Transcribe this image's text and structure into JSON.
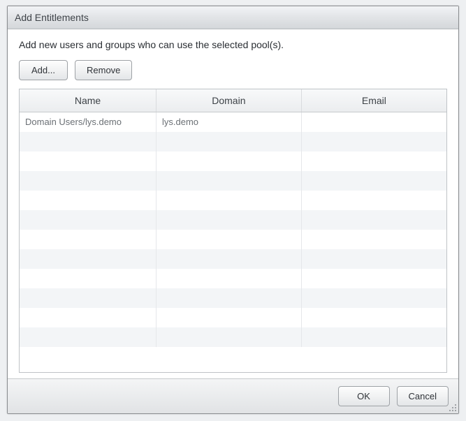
{
  "dialog": {
    "title": "Add Entitlements",
    "description": "Add new users and groups who can use the selected pool(s).",
    "toolbar": {
      "add_label": "Add...",
      "remove_label": "Remove"
    },
    "table": {
      "columns": {
        "name": "Name",
        "domain": "Domain",
        "email": "Email"
      },
      "rows": [
        {
          "name": "Domain Users/lys.demo",
          "domain": "lys.demo",
          "email": ""
        }
      ],
      "empty_row_count": 11
    },
    "footer": {
      "ok_label": "OK",
      "cancel_label": "Cancel"
    }
  }
}
